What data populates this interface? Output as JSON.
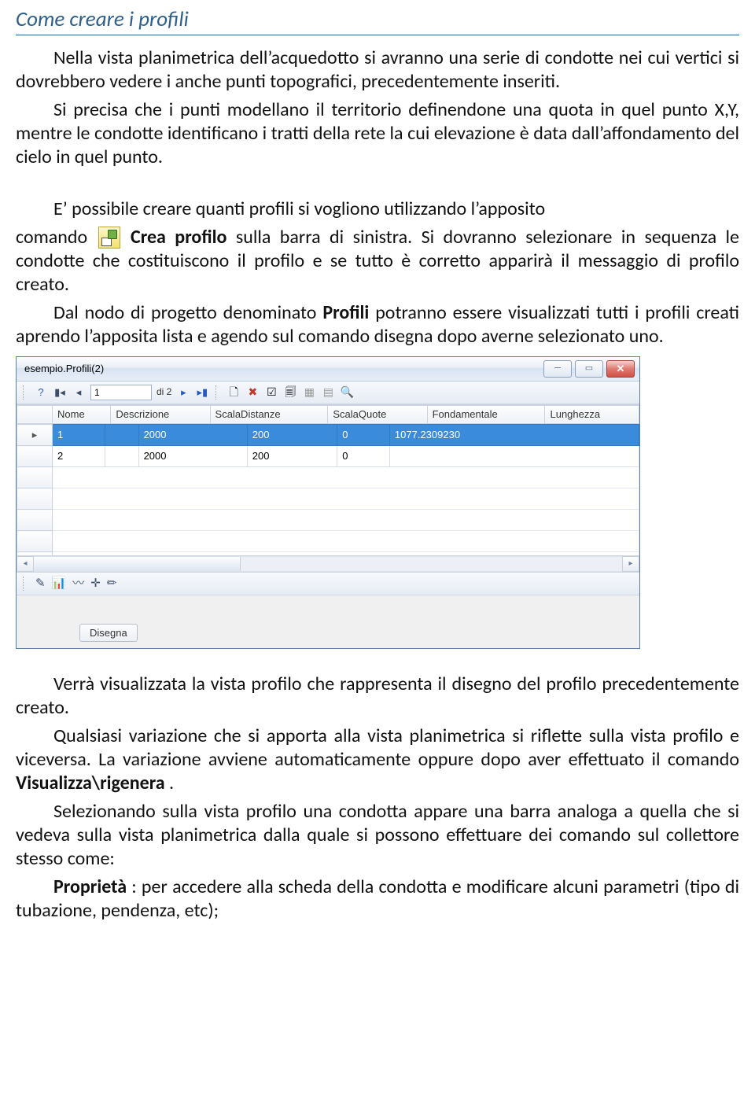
{
  "heading": "Come creare i profili",
  "para1a": "Nella vista planimetrica dell’acquedotto si avranno una serie di condotte nei cui vertici si dovrebbero vedere i anche punti topografici, precedentemente inseriti.",
  "para1b": "Si precisa che i punti modellano il territorio definendone una quota in quel punto X,Y, mentre le condotte identificano i tratti della rete la cui elevazione è data dall’affondamento del cielo in quel punto.",
  "para2": "E’ possibile creare quanti profili si vogliono utilizzando l’apposito",
  "para3_pref": "comando ",
  "para3_bold": "Crea profilo",
  "para3_rest": " sulla barra di sinistra. Si dovranno selezionare in sequenza le condotte che costituiscono il profilo e se tutto è corretto apparirà il messaggio di profilo creato.",
  "para4_pre": "Dal nodo di progetto denominato ",
  "para4_bold": "Profili",
  "para4_post": " potranno essere visualizzati tutti i profili creati aprendo l’apposita lista e agendo sul comando disegna dopo averne selezionato uno.",
  "window": {
    "title": "esempio.Profili(2)",
    "nav": {
      "page": "1",
      "of": "di 2"
    },
    "columns": [
      "Nome",
      "Descrizione",
      "ScalaDistanze",
      "ScalaQuote",
      "Fondamentale",
      "Lunghezza"
    ],
    "rows": [
      {
        "Nome": "1",
        "Descrizione": "",
        "ScalaDistanze": "2000",
        "ScalaQuote": "200",
        "Fondamentale": "0",
        "Lunghezza": "1077.2309230"
      },
      {
        "Nome": "2",
        "Descrizione": "",
        "ScalaDistanze": "2000",
        "ScalaQuote": "200",
        "Fondamentale": "0",
        "Lunghezza": ""
      }
    ],
    "disegna": "Disegna"
  },
  "para5": "Verrà visualizzata la vista profilo che rappresenta il disegno del profilo precedentemente creato.",
  "para6_pre": "Qualsiasi variazione che si apporta alla vista planimetrica si riflette sulla vista profilo e viceversa. La variazione avviene automaticamente oppure dopo aver  effettuato il comando ",
  "para6_bold": "Visualizza\\rigenera",
  "para6_post": ".",
  "para7": "Selezionando sulla vista profilo una condotta appare una barra analoga a quella che si vedeva sulla vista planimetrica dalla quale si possono effettuare dei comando sul collettore stesso come:",
  "para8_bold": "Proprietà",
  "para8_rest": ":    per accedere alla scheda della condotta e modificare alcuni parametri (tipo di tubazione, pendenza, etc);"
}
